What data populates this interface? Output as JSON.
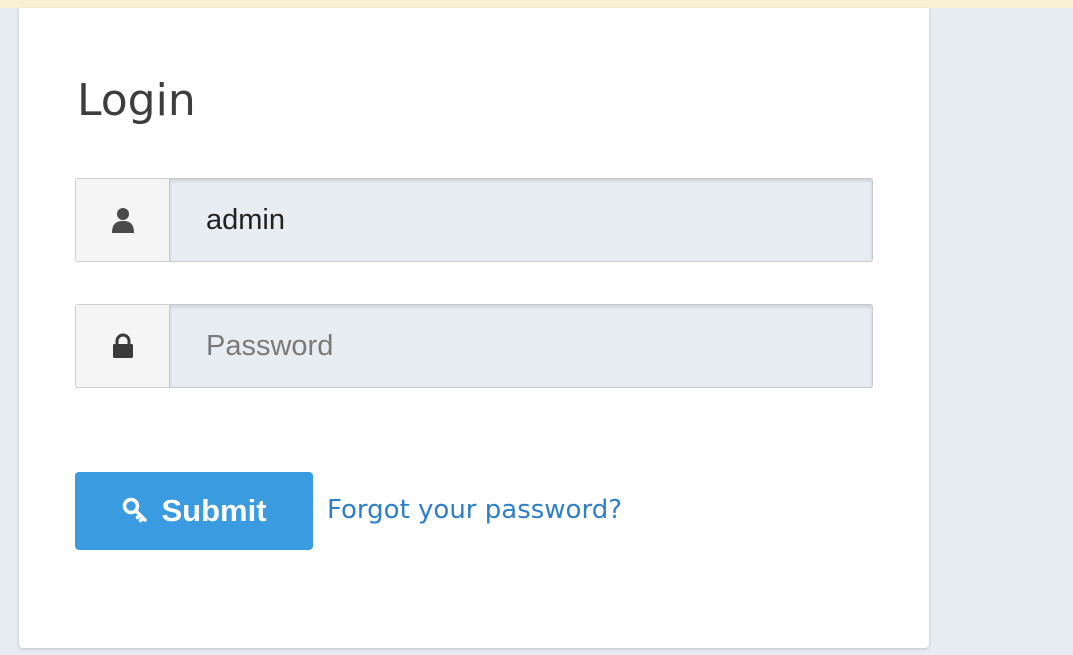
{
  "login_form": {
    "title": "Login",
    "username": {
      "icon": "user-icon",
      "value": "admin"
    },
    "password": {
      "icon": "lock-icon",
      "value": "",
      "placeholder": "Password"
    },
    "submit": {
      "icon": "key-icon",
      "label": "Submit",
      "color": "#3a9be0"
    },
    "forgot_link": "Forgot your password?"
  }
}
